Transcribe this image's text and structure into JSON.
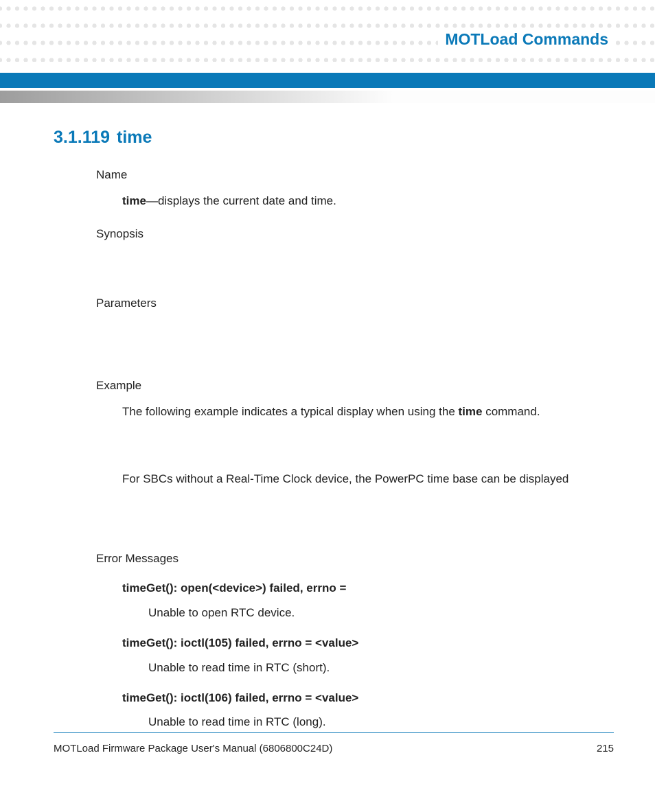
{
  "header": {
    "title": "MOTLoad Commands"
  },
  "section": {
    "number": "3.1.119",
    "title": "time"
  },
  "name": {
    "label": "Name",
    "cmd": "time",
    "dash": "—",
    "desc": "displays the current date and time."
  },
  "synopsis": {
    "label": "Synopsis"
  },
  "parameters": {
    "label": "Parameters"
  },
  "example": {
    "label": "Example",
    "line1a": "The following example indicates a typical display when using the ",
    "line1b": "time",
    "line1c": " command.",
    "line2": "For SBCs without a Real-Time Clock device, the PowerPC time base can be displayed"
  },
  "errors": {
    "label": "Error Messages",
    "items": [
      {
        "head": "timeGet(): open(<device>) failed, errno =",
        "desc": "Unable to open RTC device."
      },
      {
        "head": "timeGet(): ioctl(105) failed, errno = <value>",
        "desc": "Unable to read time in RTC (short)."
      },
      {
        "head": "timeGet(): ioctl(106) failed, errno = <value>",
        "desc": "Unable to read time in RTC (long)."
      }
    ]
  },
  "footer": {
    "doc": "MOTLoad Firmware Package User's Manual (6806800C24D)",
    "page": "215"
  }
}
